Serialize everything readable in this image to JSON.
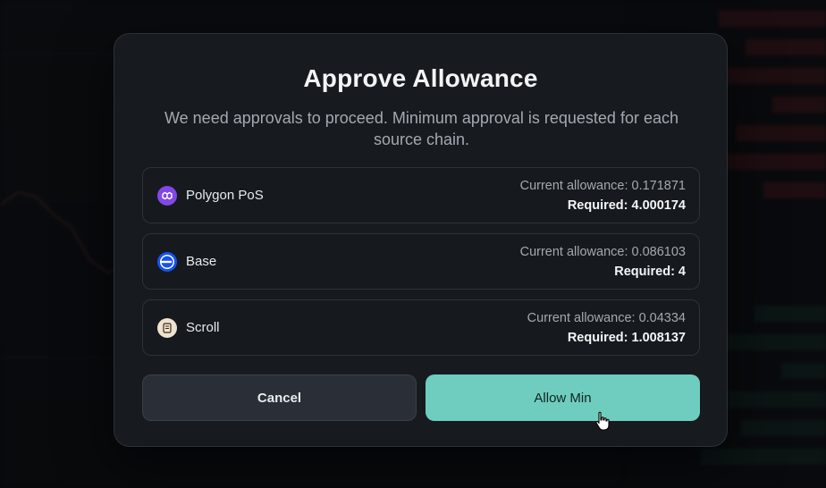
{
  "modal": {
    "title": "Approve Allowance",
    "subtitle": "We need approvals to proceed. Minimum approval is requested for each source chain."
  },
  "chains": [
    {
      "name": "Polygon PoS",
      "icon": "polygon-icon",
      "current": "Current allowance: 0.171871",
      "required": "Required: 4.000174",
      "color": "#8247e5"
    },
    {
      "name": "Base",
      "icon": "base-icon",
      "current": "Current allowance: 0.086103",
      "required": "Required: 4",
      "color": "#1652f0"
    },
    {
      "name": "Scroll",
      "icon": "scroll-icon",
      "current": "Current allowance: 0.04334",
      "required": "Required: 1.008137",
      "color": "#efe3cf"
    }
  ],
  "buttons": {
    "cancel": "Cancel",
    "allow_min": "Allow Min"
  },
  "colors": {
    "accent": "#6fcdbf",
    "background": "#171b1f"
  }
}
